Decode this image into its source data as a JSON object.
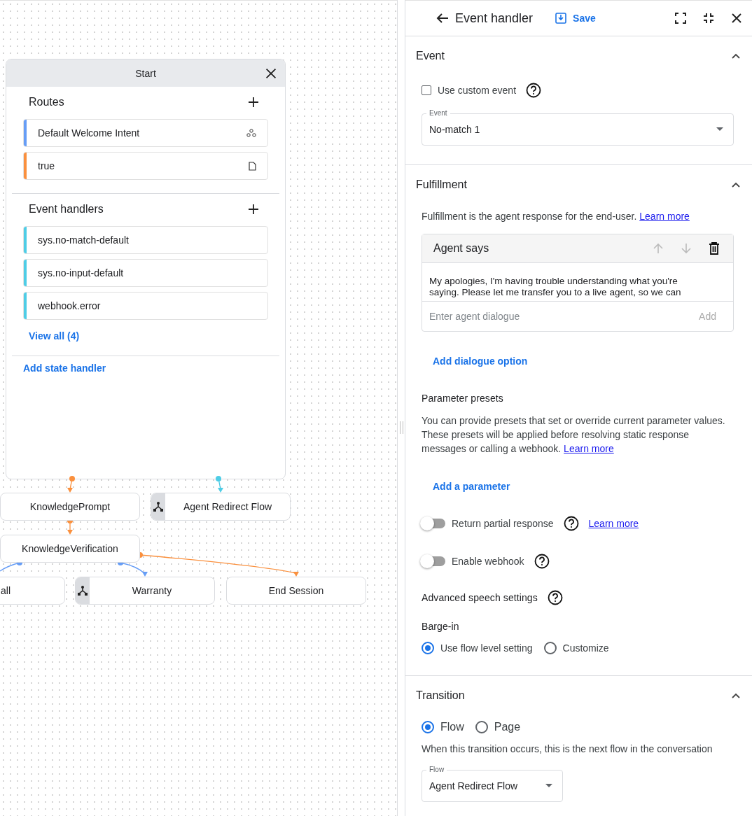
{
  "canvas": {
    "start_card": {
      "title": "Start",
      "routes_title": "Routes",
      "routes": [
        {
          "label": "Default Welcome Intent",
          "color": "#669df6",
          "kind": "intent"
        },
        {
          "label": "true",
          "color": "#fa903e",
          "kind": "condition"
        }
      ],
      "event_handlers_title": "Event handlers",
      "event_handlers": [
        {
          "label": "sys.no-match-default",
          "color": "#4ecde6"
        },
        {
          "label": "sys.no-input-default",
          "color": "#4ecde6"
        },
        {
          "label": "webhook.error",
          "color": "#4ecde6"
        }
      ],
      "view_all": "View all (4)",
      "add_state_handler": "Add state handler"
    },
    "nodes": [
      {
        "label": "KnowledgePrompt",
        "kind": "page"
      },
      {
        "label": "Agent Redirect Flow",
        "kind": "flow"
      },
      {
        "label": "KnowledgeVerification",
        "kind": "page"
      },
      {
        "label": "all",
        "kind": "page"
      },
      {
        "label": "Warranty",
        "kind": "flow"
      },
      {
        "label": "End Session",
        "kind": "page"
      }
    ]
  },
  "panel": {
    "title": "Event handler",
    "save": "Save",
    "event": {
      "title": "Event",
      "custom_event": {
        "label": "Use custom event",
        "checked": false
      },
      "field": {
        "label": "Event",
        "value": "No-match 1"
      }
    },
    "fulfillment": {
      "title": "Fulfillment",
      "description": "Fulfillment is the agent response for the end-user.",
      "description_link": "Learn more",
      "agent_says": {
        "title": "Agent says",
        "message": "My apologies, I'm having trouble understanding what you're saying. Please let me transfer you to a live agent, so we can",
        "placeholder": "Enter agent dialogue",
        "add": "Add",
        "add_disabled": true
      },
      "add_dialogue_option": "Add dialogue option",
      "parameter_presets": {
        "title": "Parameter presets",
        "description": "You can provide presets that set or override current parameter values. These presets will be applied before resolving static response messages or calling a webhook.",
        "description_link": "Learn more",
        "add": "Add a parameter"
      },
      "toggles": [
        {
          "label": "Return partial response",
          "on": false,
          "link": "Learn more"
        },
        {
          "label": "Enable webhook",
          "on": false
        }
      ],
      "advanced_speech": "Advanced speech settings",
      "barge_in": {
        "title": "Barge-in",
        "options": [
          {
            "label": "Use flow level setting",
            "selected": true
          },
          {
            "label": "Customize",
            "selected": false
          }
        ]
      }
    },
    "transition": {
      "title": "Transition",
      "options": [
        {
          "label": "Flow",
          "selected": true
        },
        {
          "label": "Page",
          "selected": false
        }
      ],
      "description": "When this transition occurs, this is the next flow in the conversation",
      "field": {
        "label": "Flow",
        "value": "Agent Redirect Flow"
      }
    }
  }
}
